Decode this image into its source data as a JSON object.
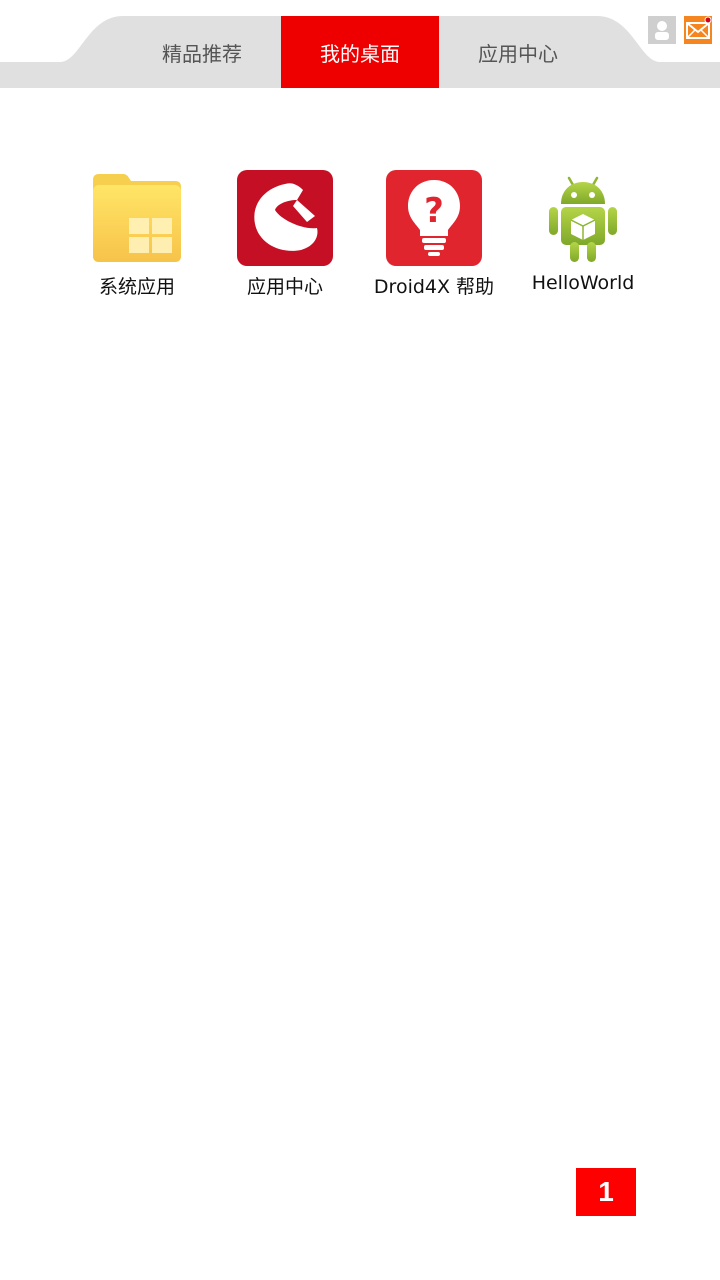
{
  "header": {
    "tabs": [
      {
        "label": "精品推荐",
        "active": false
      },
      {
        "label": "我的桌面",
        "active": true
      },
      {
        "label": "应用中心",
        "active": false
      }
    ],
    "user_icon": "user-icon",
    "mail_icon": "mail-icon",
    "mail_has_notification": true
  },
  "desktop": {
    "apps": [
      {
        "label": "系统应用",
        "icon": "folder-icon"
      },
      {
        "label": "应用中心",
        "icon": "app-center-icon"
      },
      {
        "label": "Droid4X 帮助",
        "icon": "help-lightbulb-icon"
      },
      {
        "label": "HelloWorld",
        "icon": "android-icon"
      }
    ]
  },
  "pager": {
    "current_page": "1"
  },
  "colors": {
    "accent": "#ee0000",
    "tab_bar": "#e0e0e0",
    "mail": "#f5861f",
    "pager": "#ff0000"
  }
}
